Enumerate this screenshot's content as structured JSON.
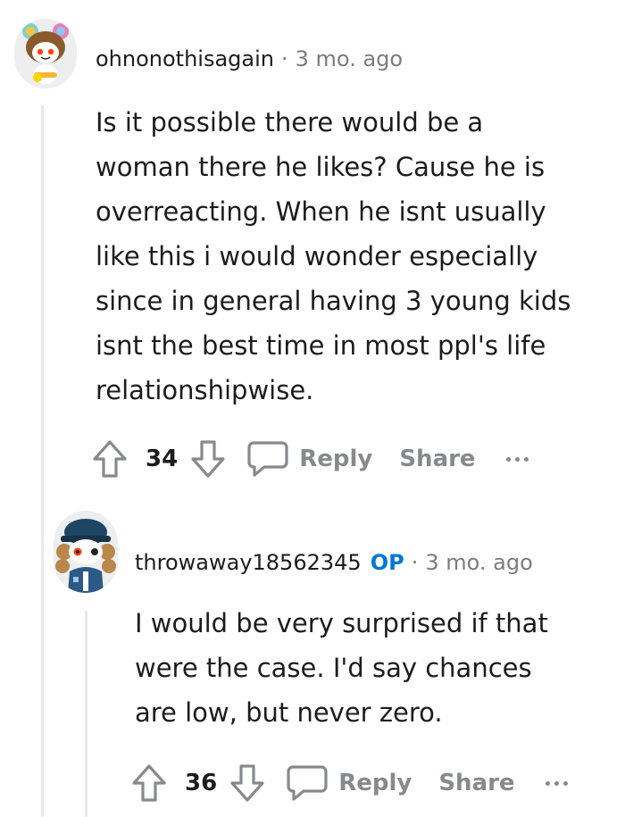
{
  "comments": [
    {
      "author": "ohnonothisagain",
      "op_badge": "",
      "time": "3 mo. ago",
      "lines": [
        "Is it possible there would be a",
        "woman there he likes? Cause he is",
        "overreacting. When he isnt usually",
        "like this i would wonder especially",
        "since in general having 3 young kids",
        "isnt the best time in most ppl's life",
        "relationshipwise."
      ],
      "score": "34",
      "reply_label": "Reply",
      "share_label": "Share",
      "avatar_icon": "snoo-avatar-bear-hat"
    },
    {
      "author": "throwaway18562345",
      "op_badge": "OP",
      "time": "3 mo. ago",
      "lines": [
        "I would be very surprised if that",
        "were the case. I'd say chances",
        "are low, but never zero."
      ],
      "score": "36",
      "reply_label": "Reply",
      "share_label": "Share",
      "avatar_icon": "snoo-avatar-cap-jacket"
    }
  ],
  "colors": {
    "op_badge": "#0079d3",
    "meta_gray": "#7c7c7c",
    "action_gray": "#878a8c",
    "thread_line": "#e7e7e7"
  }
}
